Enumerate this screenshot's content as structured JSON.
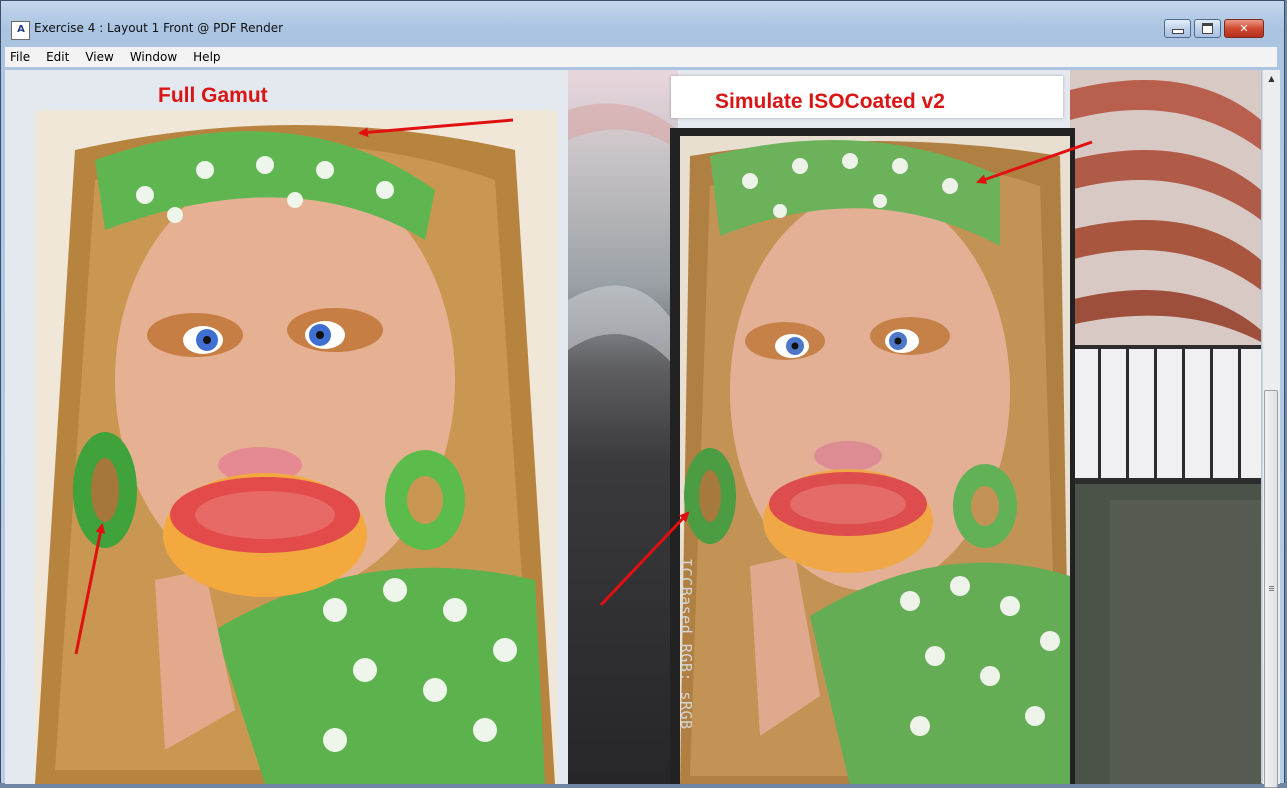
{
  "window": {
    "title": "Exercise 4 : Layout 1 Front @ PDF Render",
    "app_icon": "A",
    "controls": {
      "minimize": "",
      "maximize": "",
      "close": "✕"
    }
  },
  "menu": [
    "File",
    "Edit",
    "View",
    "Window",
    "Help"
  ],
  "annotations": {
    "left_label": "Full Gamut",
    "right_label": "Simulate ISOCoated v2",
    "vertical_text": "ICCBased RGB: sRGB",
    "arrow_color": "#e01010"
  },
  "icons": {
    "scroll_up": "triangle-up-icon",
    "scroll_grip": "grip-icon"
  }
}
